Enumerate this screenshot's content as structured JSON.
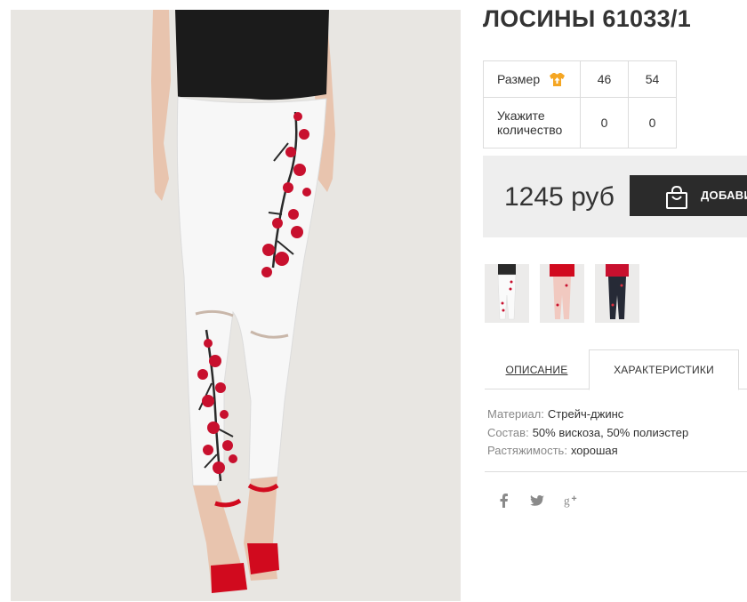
{
  "product": {
    "title": "ЛОСИНЫ 61033/1"
  },
  "sizes": {
    "size_label": "Размер",
    "quantity_label": "Укажите количество",
    "columns": [
      {
        "size": "46",
        "quantity": "0"
      },
      {
        "size": "54",
        "quantity": "0"
      }
    ]
  },
  "purchase": {
    "price": "1245 руб",
    "add_button_label": "ДОБАВИ"
  },
  "tabs": {
    "description": "ОПИСАНИЕ",
    "characteristics": "ХАРАКТЕРИСТИКИ",
    "active": "characteristics"
  },
  "characteristics": [
    {
      "key": "Материал:",
      "value": "Стрейч-джинс"
    },
    {
      "key": "Состав:",
      "value": "50% вискоза, 50% полиэстер"
    },
    {
      "key": "Растяжимость:",
      "value": "хорошая"
    }
  ],
  "icons": {
    "size_guide": "size-guide-icon",
    "bag": "shopping-bag-icon",
    "social": [
      "facebook-icon",
      "twitter-icon",
      "google-plus-icon"
    ]
  },
  "colors": {
    "accent_orange": "#f5a623",
    "button_dark": "#2b2b2b",
    "price_bg": "#eeeeee",
    "flower_red": "#c8102e"
  }
}
